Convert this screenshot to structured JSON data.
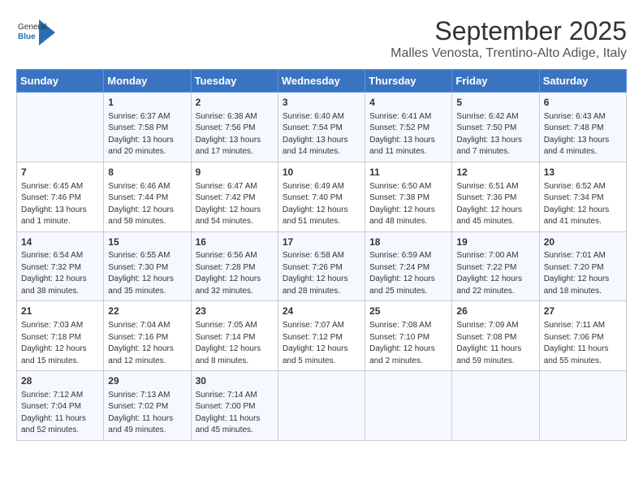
{
  "header": {
    "logo_general": "General",
    "logo_blue": "Blue",
    "month_title": "September 2025",
    "location": "Malles Venosta, Trentino-Alto Adige, Italy"
  },
  "calendar": {
    "days_of_week": [
      "Sunday",
      "Monday",
      "Tuesday",
      "Wednesday",
      "Thursday",
      "Friday",
      "Saturday"
    ],
    "weeks": [
      [
        {
          "day": "",
          "content": ""
        },
        {
          "day": "1",
          "content": "Sunrise: 6:37 AM\nSunset: 7:58 PM\nDaylight: 13 hours\nand 20 minutes."
        },
        {
          "day": "2",
          "content": "Sunrise: 6:38 AM\nSunset: 7:56 PM\nDaylight: 13 hours\nand 17 minutes."
        },
        {
          "day": "3",
          "content": "Sunrise: 6:40 AM\nSunset: 7:54 PM\nDaylight: 13 hours\nand 14 minutes."
        },
        {
          "day": "4",
          "content": "Sunrise: 6:41 AM\nSunset: 7:52 PM\nDaylight: 13 hours\nand 11 minutes."
        },
        {
          "day": "5",
          "content": "Sunrise: 6:42 AM\nSunset: 7:50 PM\nDaylight: 13 hours\nand 7 minutes."
        },
        {
          "day": "6",
          "content": "Sunrise: 6:43 AM\nSunset: 7:48 PM\nDaylight: 13 hours\nand 4 minutes."
        }
      ],
      [
        {
          "day": "7",
          "content": "Sunrise: 6:45 AM\nSunset: 7:46 PM\nDaylight: 13 hours\nand 1 minute."
        },
        {
          "day": "8",
          "content": "Sunrise: 6:46 AM\nSunset: 7:44 PM\nDaylight: 12 hours\nand 58 minutes."
        },
        {
          "day": "9",
          "content": "Sunrise: 6:47 AM\nSunset: 7:42 PM\nDaylight: 12 hours\nand 54 minutes."
        },
        {
          "day": "10",
          "content": "Sunrise: 6:49 AM\nSunset: 7:40 PM\nDaylight: 12 hours\nand 51 minutes."
        },
        {
          "day": "11",
          "content": "Sunrise: 6:50 AM\nSunset: 7:38 PM\nDaylight: 12 hours\nand 48 minutes."
        },
        {
          "day": "12",
          "content": "Sunrise: 6:51 AM\nSunset: 7:36 PM\nDaylight: 12 hours\nand 45 minutes."
        },
        {
          "day": "13",
          "content": "Sunrise: 6:52 AM\nSunset: 7:34 PM\nDaylight: 12 hours\nand 41 minutes."
        }
      ],
      [
        {
          "day": "14",
          "content": "Sunrise: 6:54 AM\nSunset: 7:32 PM\nDaylight: 12 hours\nand 38 minutes."
        },
        {
          "day": "15",
          "content": "Sunrise: 6:55 AM\nSunset: 7:30 PM\nDaylight: 12 hours\nand 35 minutes."
        },
        {
          "day": "16",
          "content": "Sunrise: 6:56 AM\nSunset: 7:28 PM\nDaylight: 12 hours\nand 32 minutes."
        },
        {
          "day": "17",
          "content": "Sunrise: 6:58 AM\nSunset: 7:26 PM\nDaylight: 12 hours\nand 28 minutes."
        },
        {
          "day": "18",
          "content": "Sunrise: 6:59 AM\nSunset: 7:24 PM\nDaylight: 12 hours\nand 25 minutes."
        },
        {
          "day": "19",
          "content": "Sunrise: 7:00 AM\nSunset: 7:22 PM\nDaylight: 12 hours\nand 22 minutes."
        },
        {
          "day": "20",
          "content": "Sunrise: 7:01 AM\nSunset: 7:20 PM\nDaylight: 12 hours\nand 18 minutes."
        }
      ],
      [
        {
          "day": "21",
          "content": "Sunrise: 7:03 AM\nSunset: 7:18 PM\nDaylight: 12 hours\nand 15 minutes."
        },
        {
          "day": "22",
          "content": "Sunrise: 7:04 AM\nSunset: 7:16 PM\nDaylight: 12 hours\nand 12 minutes."
        },
        {
          "day": "23",
          "content": "Sunrise: 7:05 AM\nSunset: 7:14 PM\nDaylight: 12 hours\nand 8 minutes."
        },
        {
          "day": "24",
          "content": "Sunrise: 7:07 AM\nSunset: 7:12 PM\nDaylight: 12 hours\nand 5 minutes."
        },
        {
          "day": "25",
          "content": "Sunrise: 7:08 AM\nSunset: 7:10 PM\nDaylight: 12 hours\nand 2 minutes."
        },
        {
          "day": "26",
          "content": "Sunrise: 7:09 AM\nSunset: 7:08 PM\nDaylight: 11 hours\nand 59 minutes."
        },
        {
          "day": "27",
          "content": "Sunrise: 7:11 AM\nSunset: 7:06 PM\nDaylight: 11 hours\nand 55 minutes."
        }
      ],
      [
        {
          "day": "28",
          "content": "Sunrise: 7:12 AM\nSunset: 7:04 PM\nDaylight: 11 hours\nand 52 minutes."
        },
        {
          "day": "29",
          "content": "Sunrise: 7:13 AM\nSunset: 7:02 PM\nDaylight: 11 hours\nand 49 minutes."
        },
        {
          "day": "30",
          "content": "Sunrise: 7:14 AM\nSunset: 7:00 PM\nDaylight: 11 hours\nand 45 minutes."
        },
        {
          "day": "",
          "content": ""
        },
        {
          "day": "",
          "content": ""
        },
        {
          "day": "",
          "content": ""
        },
        {
          "day": "",
          "content": ""
        }
      ]
    ]
  }
}
